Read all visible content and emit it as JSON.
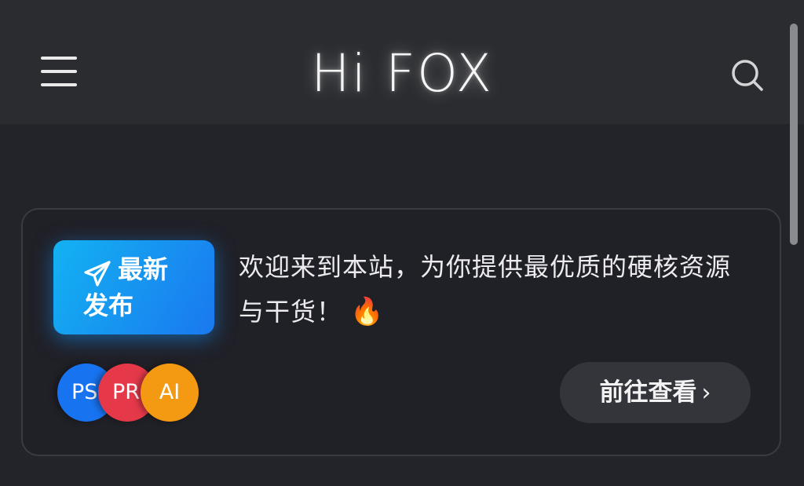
{
  "header": {
    "logo_text": "Hi FOX",
    "menu_icon": "hamburger-menu-icon",
    "search_icon": "search-icon"
  },
  "card": {
    "badge": {
      "icon": "paper-plane-icon",
      "line1": "最新",
      "line2": "发布"
    },
    "welcome_text": "欢迎来到本站，为你提供最优质的硬核资源与干货！",
    "welcome_emoji": "🔥",
    "avatars": [
      {
        "label": "PS",
        "color": "#1873f0"
      },
      {
        "label": "PR",
        "color": "#e5394a"
      },
      {
        "label": "AI",
        "color": "#f39a12"
      }
    ],
    "cta_label": "前往查看",
    "cta_chevron": "›"
  },
  "colors": {
    "background": "#232429",
    "header_bg": "#2b2c30",
    "badge_gradient_start": "#13b2f2",
    "badge_gradient_end": "#1a78ef"
  }
}
